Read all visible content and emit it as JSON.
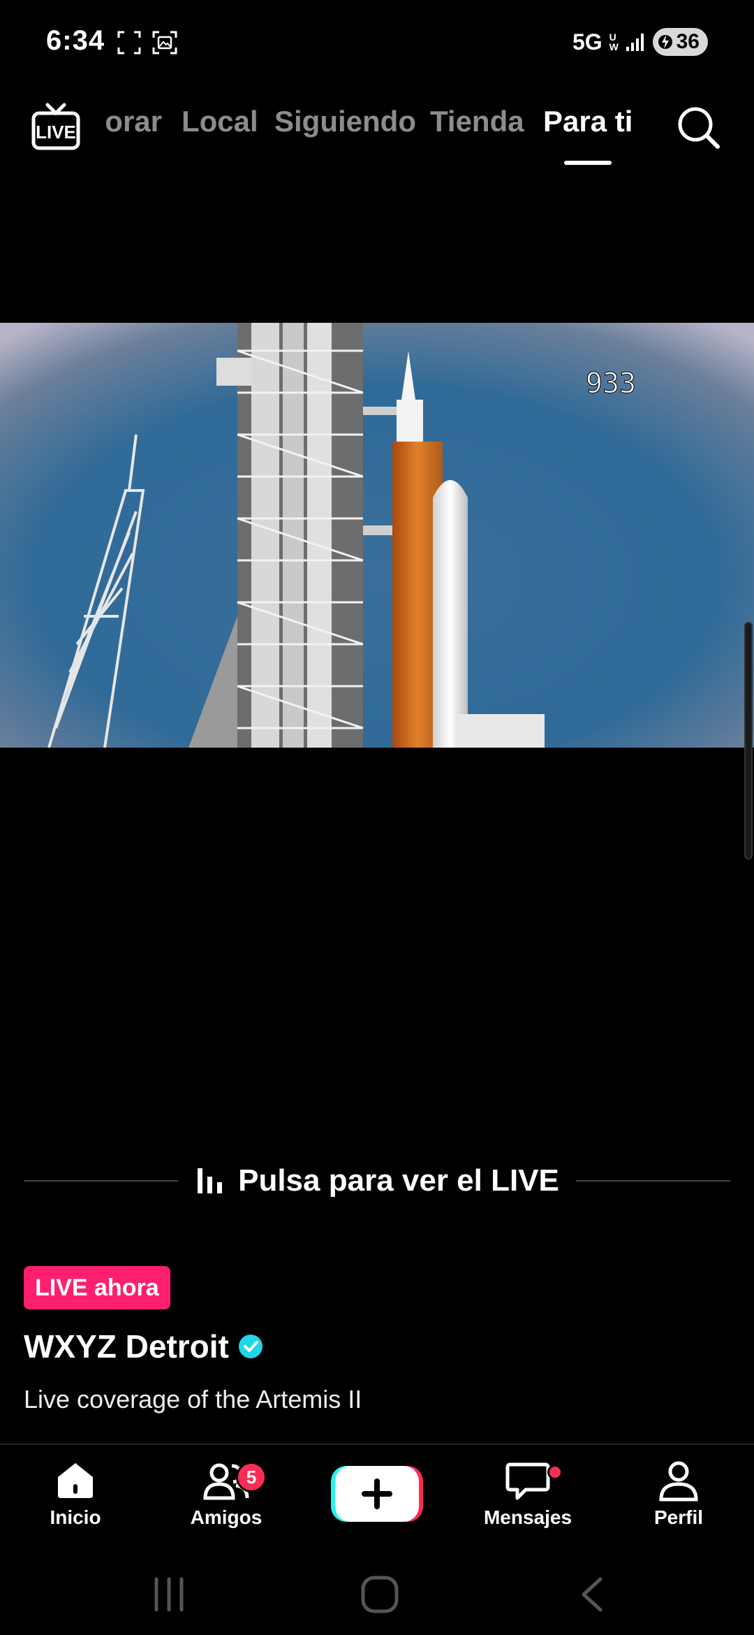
{
  "status": {
    "time": "6:34",
    "network": "5G",
    "network_sub": "UW",
    "battery": "36"
  },
  "nav": {
    "tabs": [
      "orar",
      "Local",
      "Siguiendo",
      "Tienda",
      "Para ti"
    ],
    "active_tab": "Para ti"
  },
  "video": {
    "overlay_counter": "933"
  },
  "cta": {
    "tap_label": "Pulsa para ver el LIVE",
    "live_badge": "LIVE ahora",
    "account_name": "WXYZ Detroit",
    "caption": "Live coverage of the Artemis II"
  },
  "bottom_nav": {
    "home": "Inicio",
    "friends": "Amigos",
    "friends_badge": "5",
    "messages": "Mensajes",
    "profile": "Perfil"
  },
  "colors": {
    "accent_pink": "#ff1f6e",
    "verified_cyan": "#20d5ec",
    "notification_red": "#ff2c55"
  }
}
